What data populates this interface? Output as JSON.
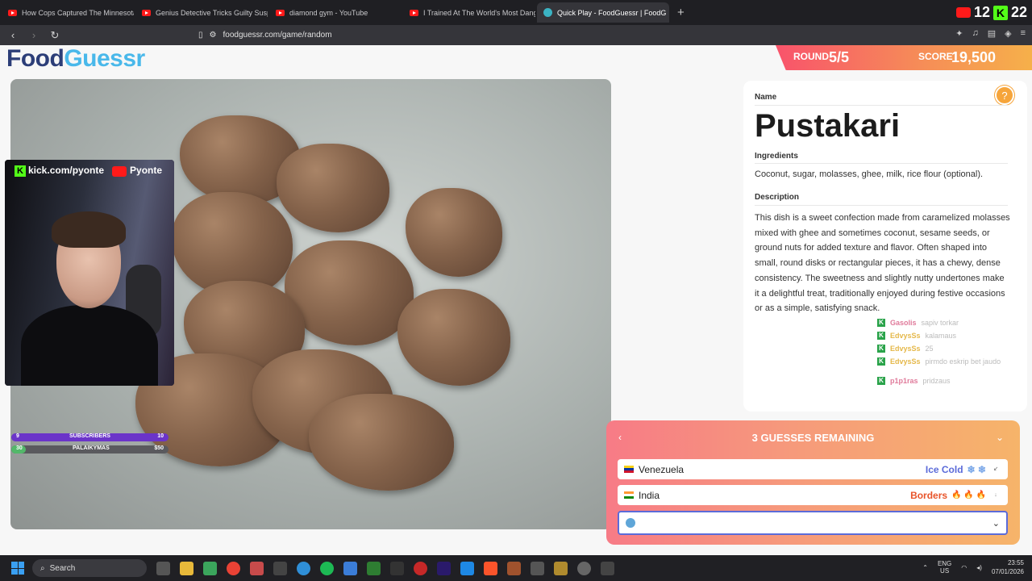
{
  "browser": {
    "tabs": [
      {
        "title": "How Cops Captured The Minnesota I",
        "icon": "youtube-icon"
      },
      {
        "title": "Genius Detective Tricks Guilty Suspe",
        "icon": "youtube-icon"
      },
      {
        "title": "diamond gym - YouTube",
        "icon": "youtube-icon"
      },
      {
        "title": "I Trained At The World's Most Dange",
        "icon": "youtube-icon"
      },
      {
        "title": "Quick Play - FoodGuessr | FoodG",
        "icon": "globe-icon",
        "active": true
      }
    ],
    "new_tab": "+",
    "url": "foodguessr.com/game/random",
    "overlay_counts": {
      "youtube": "12",
      "kick": "22"
    }
  },
  "app": {
    "logo_food": "Food",
    "logo_guessr": "Guessr",
    "round_label": "ROUND",
    "round_value": "5/5",
    "score_label": "SCORE",
    "score_value": "19,500"
  },
  "stream": {
    "kick_handle": "kick.com/pyonte",
    "youtube_handle": "Pyonte",
    "subs_left": "9",
    "subs_label": "SUBSCRIBERS",
    "subs_right": "10",
    "subs_progress": 0.9,
    "goal_left": "30",
    "goal_label": "PALAIKYMAS",
    "goal_right": "$50",
    "goal_progress": 0.6
  },
  "dish": {
    "name_label": "Name",
    "name": "Pustakari",
    "ingredients_label": "Ingredients",
    "ingredients": "Coconut, sugar, molasses, ghee, milk, rice flour (optional).",
    "description_label": "Description",
    "description": "This dish is a sweet confection made from caramelized molasses mixed with ghee and sometimes coconut, sesame seeds, or ground nuts for added texture and flavor. Often shaped into small, round disks or rectangular pieces, it has a chewy, dense consistency. The sweetness and slightly nutty undertones make it a delightful treat, traditionally enjoyed during festive occasions or as a simple, satisfying snack."
  },
  "chat": [
    {
      "name": "Gasolis",
      "msg": "sapiv torkar",
      "color": "#e07b9b"
    },
    {
      "name": "EdvysSs",
      "msg": "kalamaus",
      "color": "#e5b84a"
    },
    {
      "name": "EdvysSs",
      "msg": "25",
      "color": "#e5b84a"
    },
    {
      "name": "EdvysSs",
      "msg": "pirmdo eskrip bet jaudo",
      "color": "#e5b84a"
    },
    {
      "name": "p1p1ras",
      "msg": "pridzaus",
      "color": "#e07b9b"
    }
  ],
  "guess_panel": {
    "title": "3 GUESSES REMAINING",
    "guesses": [
      {
        "country": "Venezuela",
        "result": "Ice Cold",
        "result_color": "#5b6bd9",
        "icons": "❄ ❄"
      },
      {
        "country": "India",
        "result": "Borders",
        "result_color": "#e8542a",
        "icons": "🔥 🔥 🔥"
      }
    ],
    "input_value": ""
  },
  "taskbar": {
    "search_placeholder": "Search",
    "lang": "ENG",
    "region": "US",
    "time": "23:55",
    "date": "07/01/2026"
  }
}
